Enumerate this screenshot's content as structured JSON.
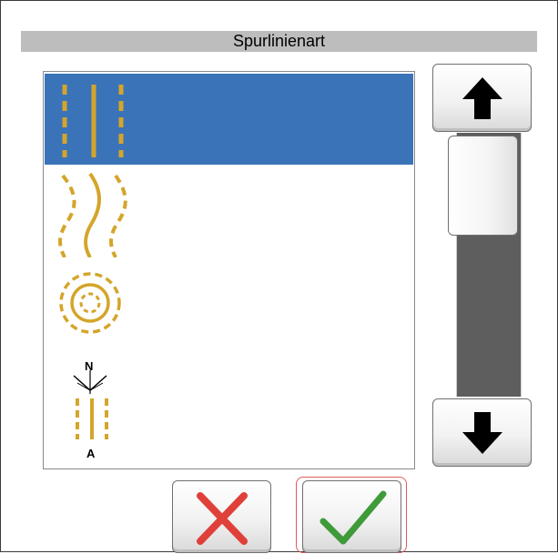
{
  "dialog": {
    "title": "Spurlinienart"
  },
  "list": {
    "items": [
      {
        "icon": "straight-track-lines-icon",
        "selected": true
      },
      {
        "icon": "curved-track-lines-icon",
        "selected": false
      },
      {
        "icon": "concentric-circle-track-lines-icon",
        "selected": false
      },
      {
        "icon": "ab-line-north-arrow-icon",
        "selected": false,
        "labels": [
          "N",
          "A"
        ]
      }
    ]
  },
  "scrollbar": {
    "up_icon": "arrow-up-icon",
    "down_icon": "arrow-down-icon"
  },
  "buttons": {
    "cancel_icon": "x-mark-icon",
    "ok_icon": "checkmark-icon"
  },
  "colors": {
    "selection": "#3b73b9",
    "track_icon": "#d4a52a",
    "cancel": "#e0403a",
    "ok": "#3f9a3a",
    "title_bar": "#bdbdbd"
  }
}
